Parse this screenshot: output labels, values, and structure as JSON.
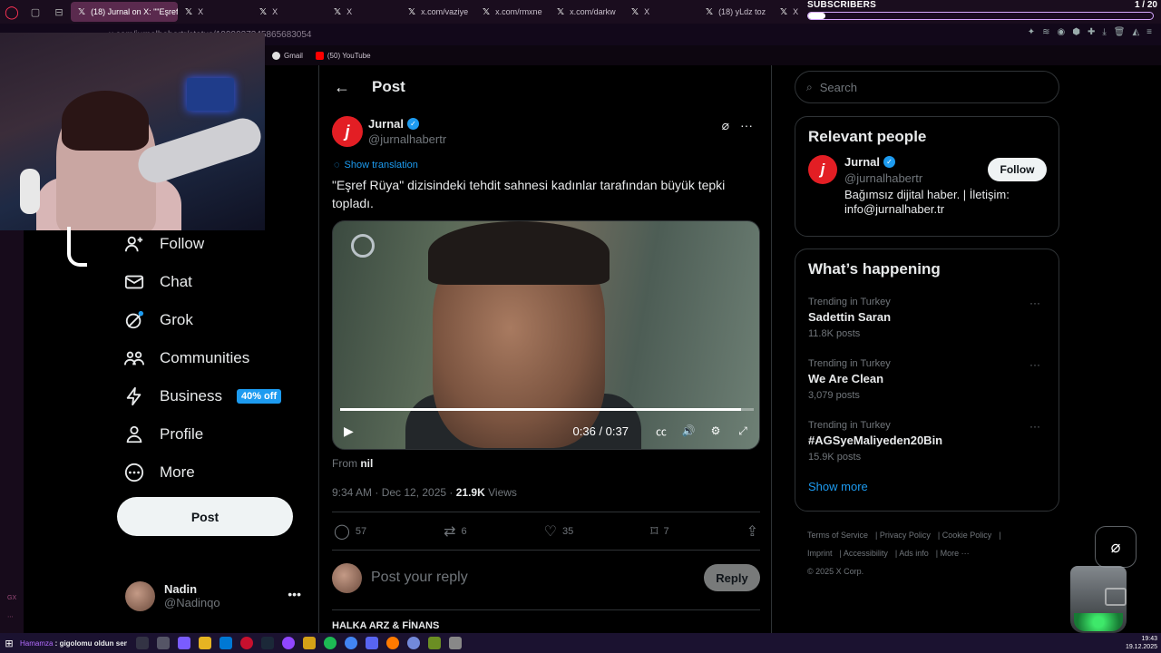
{
  "browser": {
    "active_tab": "(18) Jurnal on X: \"\"Eşref",
    "tabs": [
      "X",
      "X",
      "X",
      "x.com/vaziye",
      "x.com/rmxne",
      "x.com/darkw",
      "X",
      "(18) yLdz toz",
      "X"
    ],
    "url": "x.com/jurnalhabertr/status/1999037345865683054",
    "bookmarks": [
      "Gmail",
      "(50) YouTube"
    ]
  },
  "overlay": {
    "subscribers_label": "SUBSCRIBERS",
    "subscribers_count": "1 / 20",
    "subscribers_progress": 0.05
  },
  "nav": {
    "items": [
      {
        "label": "Follow",
        "icon": "follow-icon"
      },
      {
        "label": "Chat",
        "icon": "mail-icon"
      },
      {
        "label": "Grok",
        "icon": "grok-icon"
      },
      {
        "label": "Communities",
        "icon": "communities-icon"
      },
      {
        "label": "Business",
        "icon": "lightning-icon",
        "badge": "40% off"
      },
      {
        "label": "Profile",
        "icon": "person-icon"
      },
      {
        "label": "More",
        "icon": "more-circle-icon"
      }
    ],
    "post_button": "Post",
    "account": {
      "name": "Nadin",
      "handle": "@Nadinqo"
    }
  },
  "post": {
    "header_title": "Post",
    "author_name": "Jurnal",
    "author_handle": "@jurnalhabertr",
    "avatar_letter": "j",
    "show_translation": "Show translation",
    "text": "\"Eşref Rüya\" dizisindeki tehdit sahnesi kadınlar tarafından büyük tepki topladı.",
    "video": {
      "time": "0:36 / 0:37",
      "progress": 0.97
    },
    "from_label": "From",
    "from_value": "nil",
    "timestamp": "9:34 AM · Dec 12, 2025 · ",
    "views_count": "21.9K",
    "views_label": " Views",
    "stats": {
      "replies": "57",
      "reposts": "6",
      "likes": "35",
      "bookmarks": "7"
    },
    "reply_placeholder": "Post your reply",
    "reply_button": "Reply",
    "next_post_author": "HALKA ARZ & FİNANS"
  },
  "sidebar": {
    "search_placeholder": "Search",
    "relevant_title": "Relevant people",
    "relevant": {
      "name": "Jurnal",
      "handle": "@jurnalhabertr",
      "bio": "Bağımsız dijital haber. | İletişim: info@jurnalhaber.tr",
      "follow_label": "Follow"
    },
    "happening_title": "What’s happening",
    "trends": [
      {
        "context": "Trending in Turkey",
        "name": "Sadettin Saran",
        "count": "11.8K posts"
      },
      {
        "context": "Trending in Turkey",
        "name": "We Are Clean",
        "count": "3,079 posts"
      },
      {
        "context": "Trending in Turkey",
        "name": "#AGSyeMaliyeden20Bin",
        "count": "15.9K posts"
      }
    ],
    "show_more": "Show more",
    "footer": [
      "Terms of Service",
      "Privacy Policy",
      "Cookie Policy",
      "Imprint",
      "Accessibility",
      "Ads info",
      "More ···",
      "© 2025 X Corp."
    ]
  },
  "taskbar": {
    "ticker_highlight": "Hamamza",
    "ticker_text": " : gigolomu oldun sende",
    "time": "19:43",
    "date": "19.12.2025"
  },
  "colors": {
    "accent": "#1d9bf0",
    "brand_red": "#e31e24",
    "background": "#000000"
  }
}
